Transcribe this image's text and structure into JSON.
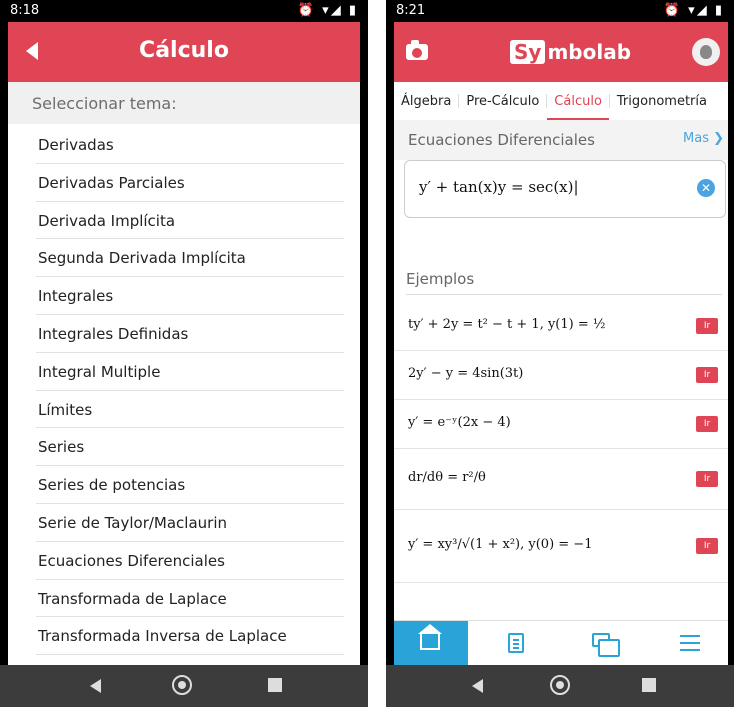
{
  "left": {
    "status_time": "8:18",
    "status_icons": "⏰ ▾◢ ▮",
    "title": "Cálculo",
    "subheader": "Seleccionar tema:",
    "topics": [
      "Derivadas",
      "Derivadas Parciales",
      "Derivada Implícita",
      "Segunda Derivada Implícita",
      "Integrales",
      "Integrales Definidas",
      "Integral Multiple",
      "Límites",
      "Series",
      "Series de potencias",
      "Serie de Taylor/Maclaurin",
      "Ecuaciones Diferenciales",
      "Transformada de Laplace",
      "Transformada Inversa de Laplace"
    ]
  },
  "right": {
    "status_time": "8:21",
    "status_icons": "⏰ ▾◢ ▮",
    "logo_part1": "Sy",
    "logo_part2": "mbolab",
    "tabs": [
      "Álgebra",
      "Pre-Cálculo",
      "Cálculo",
      "Trigonometría"
    ],
    "active_tab": "Cálculo",
    "section_label": "Ecuaciones Diferenciales",
    "more_link": "Mas ❯",
    "input_value": "y′ + tan(x)y = sec(x)|",
    "examples_label": "Ejemplos",
    "go_label": "Ir",
    "examples": [
      "ty′ + 2y = t² − t + 1, y(1) = ½",
      "2y′ − y = 4sin(3t)",
      "y′ = e⁻ʸ(2x − 4)",
      "dr/dθ = r²/θ",
      "y′ = xy³/√(1 + x²), y(0) = −1"
    ]
  },
  "colors": {
    "brand_red": "#e04555",
    "accent_blue": "#2aa3d8"
  }
}
